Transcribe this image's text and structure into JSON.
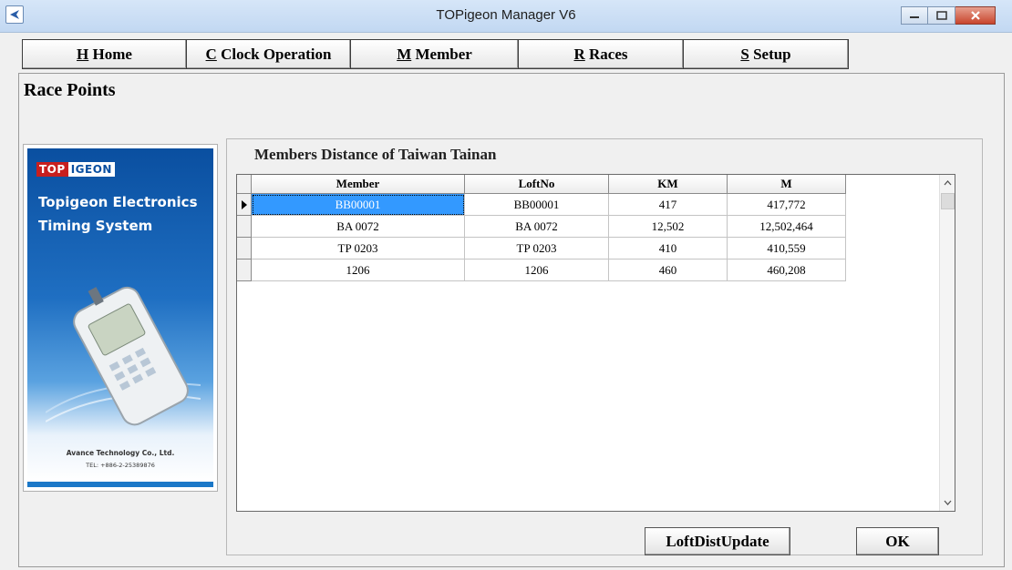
{
  "window": {
    "title": "TOPigeon Manager V6"
  },
  "menu": [
    {
      "accel": "H",
      "label": "Home"
    },
    {
      "accel": "C",
      "label": "Clock Operation"
    },
    {
      "accel": "M",
      "label": "Member"
    },
    {
      "accel": "R",
      "label": "Races"
    },
    {
      "accel": "S",
      "label": "Setup"
    }
  ],
  "page": {
    "title": "Race Points"
  },
  "banner": {
    "logo_a": "TOP",
    "logo_b": "IGEON",
    "line1": "Topigeon Electronics",
    "line2": "Timing System",
    "company": "Avance Technology Co., Ltd.",
    "tel": "TEL: +886-2-25389876"
  },
  "group": {
    "title": "Members Distance of Taiwan Tainan"
  },
  "table": {
    "columns": [
      "Member",
      "LoftNo",
      "KM",
      "M"
    ],
    "rows": [
      [
        "BB00001",
        "BB00001",
        "417",
        "417,772"
      ],
      [
        "BA 0072",
        "BA 0072",
        "12,502",
        "12,502,464"
      ],
      [
        "TP 0203",
        "TP 0203",
        "410",
        "410,559"
      ],
      [
        "1206",
        "1206",
        "460",
        "460,208"
      ]
    ]
  },
  "buttons": {
    "loft_update": "LoftDistUpdate",
    "ok": "OK"
  },
  "colors": {
    "selection": "#3399ff",
    "banner_blue": "#0a4fa0"
  }
}
